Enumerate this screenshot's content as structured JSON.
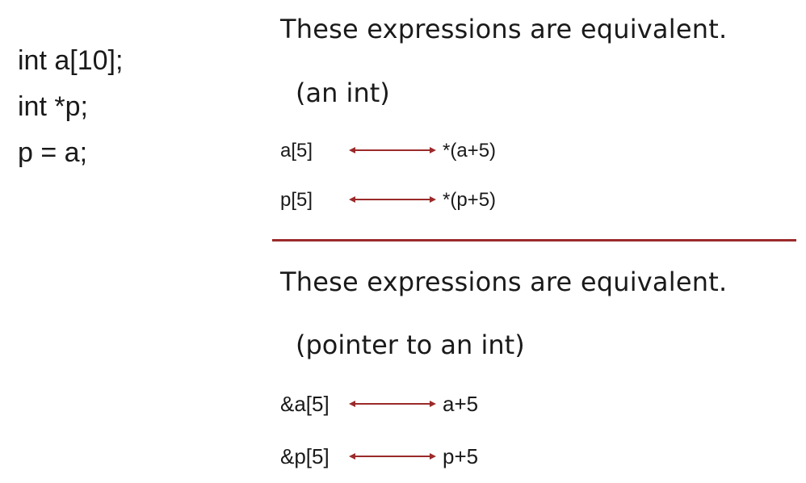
{
  "declarations": [
    "int a[10];",
    "int *p;",
    "p = a;"
  ],
  "section1": {
    "heading": "These expressions are equivalent.",
    "subheading": "(an int)",
    "rows": [
      {
        "left": "a[5]",
        "right": "*(a+5)"
      },
      {
        "left": "p[5]",
        "right": "*(p+5)"
      }
    ]
  },
  "section2": {
    "heading": "These expressions are equivalent.",
    "subheading": "(pointer to an int)",
    "rows": [
      {
        "left": "&a[5]",
        "right": "a+5"
      },
      {
        "left": "&p[5]",
        "right": "p+5"
      }
    ]
  },
  "colors": {
    "accent": "#9b2a2a",
    "text": "#1a1a1a"
  }
}
